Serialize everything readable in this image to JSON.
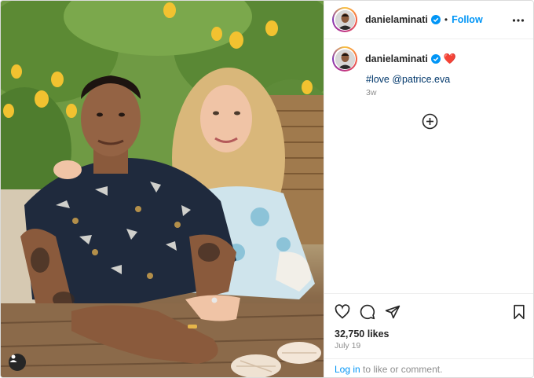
{
  "post": {
    "username": "danielaminati",
    "verified": true,
    "follow_label": "Follow",
    "separator": "•",
    "caption": {
      "username": "danielaminati",
      "emoji": "❤️",
      "text": "#love @patrice.eva",
      "time_ago": "3w"
    },
    "likes": "32,750 likes",
    "date": "July 19",
    "login_link": "Log in",
    "login_text": " to like or comment."
  },
  "icons": {
    "verified": "verified-badge-icon",
    "more": "more-options-icon",
    "load_more": "plus-circle-icon",
    "like": "heart-icon",
    "comment": "comment-icon",
    "share": "send-icon",
    "save": "bookmark-icon",
    "tags": "user-tag-icon"
  },
  "colors": {
    "accent": "#0095f6",
    "hashtag": "#00376b",
    "verified": "#0095f6",
    "heart": "#ed4956"
  }
}
